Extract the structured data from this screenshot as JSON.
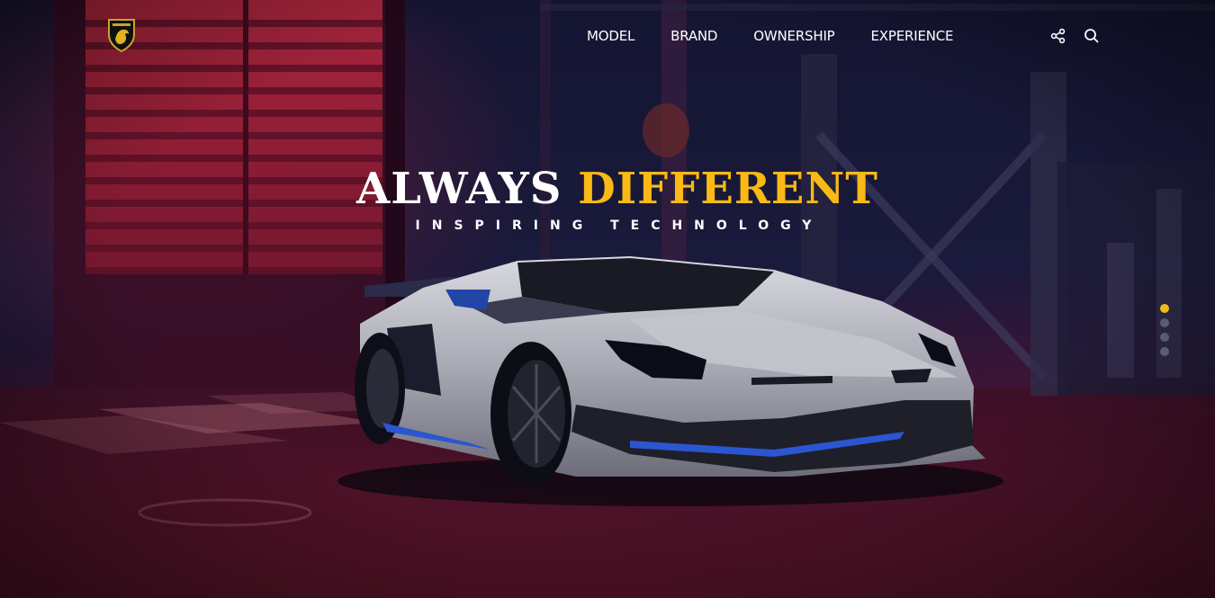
{
  "brand": {
    "logo_icon": "lamborghini-bull-shield-icon"
  },
  "nav": {
    "items": [
      {
        "label": "MODEL"
      },
      {
        "label": "BRAND"
      },
      {
        "label": "OWNERSHIP"
      },
      {
        "label": "EXPERIENCE"
      }
    ]
  },
  "actions": {
    "share_icon": "share-icon",
    "search_icon": "search-icon"
  },
  "hero": {
    "headline_white": "ALWAYS",
    "headline_accent": "DIFFERENT",
    "subheadline": "INSPIRING TECHNOLOGY"
  },
  "slider": {
    "count": 4,
    "active_index": 0
  },
  "colors": {
    "accent": "#fab915",
    "nav_text": "#ffffff",
    "dot_inactive": "#5a5c70",
    "dot_active": "#f6bb12"
  }
}
